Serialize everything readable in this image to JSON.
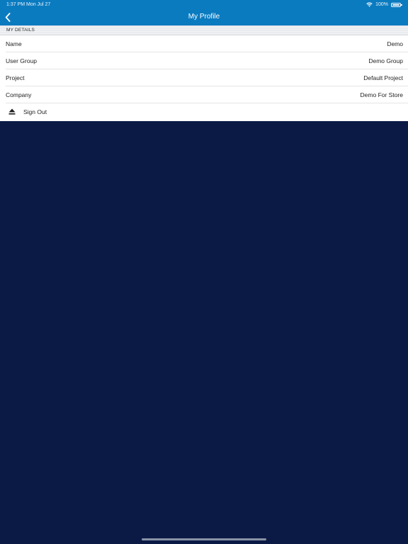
{
  "status_bar": {
    "time": "1:37 PM  Mon Jul 27",
    "wifi_icon": "wifi-icon",
    "battery_percent": "100%",
    "battery_icon": "battery-full-icon"
  },
  "nav": {
    "back_icon": "chevron-left-icon",
    "title": "My Profile"
  },
  "details": {
    "section_title": "MY DETAILS",
    "rows": [
      {
        "label": "Name",
        "value": "Demo"
      },
      {
        "label": "User Group",
        "value": "Demo Group"
      },
      {
        "label": "Project",
        "value": "Default Project"
      },
      {
        "label": "Company",
        "value": "Demo For Store"
      }
    ],
    "sign_out": {
      "icon": "eject-icon",
      "label": "Sign Out"
    }
  },
  "colors": {
    "header": "#0b7bc0",
    "background": "#0b1a45",
    "panel": "#ffffff",
    "section_header": "#e9ebee"
  }
}
